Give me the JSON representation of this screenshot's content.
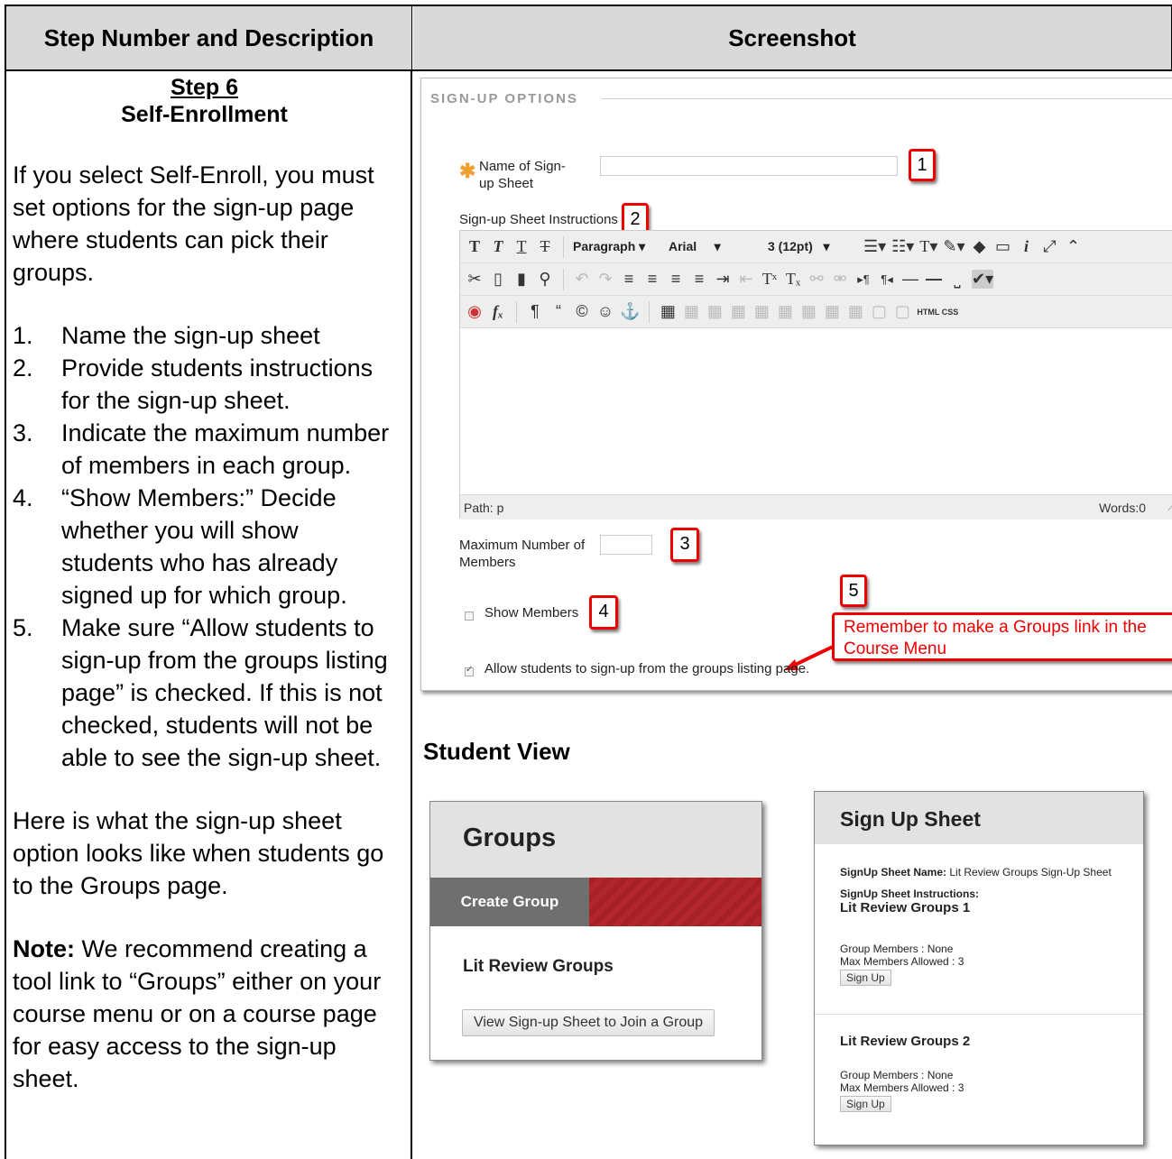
{
  "table": {
    "header_left": "Step Number and Description",
    "header_right": "Screenshot"
  },
  "step": {
    "number": "Step 6",
    "title": "Self-Enrollment",
    "intro": "If you select Self-Enroll, you must set options for the sign-up page where students can pick their groups.",
    "items": [
      {
        "n": "1.",
        "text": "Name the sign-up sheet"
      },
      {
        "n": "2.",
        "text": "Provide students instructions for the sign-up sheet."
      },
      {
        "n": "3.",
        "text": "Indicate the maximum number of members in each group."
      },
      {
        "n": "4.",
        "text": "“Show Members:” Decide whether you will show students who has already signed up for which group."
      },
      {
        "n": "5.",
        "text": "Make sure “Allow students to sign-up from the groups listing page” is checked. If this is not checked, students will not be able to see the sign-up sheet."
      }
    ],
    "closing": "Here is what the sign-up sheet option looks like when students go to the Groups page.",
    "note_label": "Note:",
    "note_text": " We recommend creating a tool link to “Groups” either on your course menu or on a course page for easy access to the sign-up sheet."
  },
  "signup_options": {
    "section_title": "SIGN-UP OPTIONS",
    "required_mark": "✱",
    "name_label": "Name of Sign-up Sheet",
    "instructions_label": "Sign-up Sheet Instructions",
    "editor": {
      "format_dropdown": "Paragraph",
      "font_dropdown": "Arial",
      "size_dropdown": "3 (12pt)",
      "html_css_label": "HTML CSS",
      "path_label": "Path: p",
      "words_label": "Words:0"
    },
    "max_label": "Maximum Number of Members",
    "show_members_label": "Show Members",
    "allow_label": "Allow students to sign-up from the groups listing page.",
    "show_members_checked": false,
    "allow_checked": true,
    "callouts": [
      "1",
      "2",
      "3",
      "4",
      "5"
    ],
    "callout5_text": "Remember to make a Groups link in the Course Menu",
    "callout_color": "#e00000"
  },
  "student_view": {
    "heading": "Student View",
    "groups_page": {
      "title": "Groups",
      "create_button": "Create Group",
      "group_name": "Lit Review Groups",
      "view_button": "View Sign-up Sheet to Join a Group"
    },
    "sheet_page": {
      "title": "Sign Up Sheet",
      "name_label": "SignUp Sheet Name:",
      "name_value": " Lit Review Groups Sign-Up Sheet",
      "instructions_label": "SignUp Sheet Instructions:",
      "groups": [
        {
          "name": "Lit Review Groups 1",
          "members": "Group Members : None",
          "max": "Max Members Allowed : 3",
          "button": "Sign Up"
        },
        {
          "name": "Lit Review Groups 2",
          "members": "Group Members : None",
          "max": "Max Members Allowed : 3",
          "button": "Sign Up"
        }
      ]
    }
  }
}
